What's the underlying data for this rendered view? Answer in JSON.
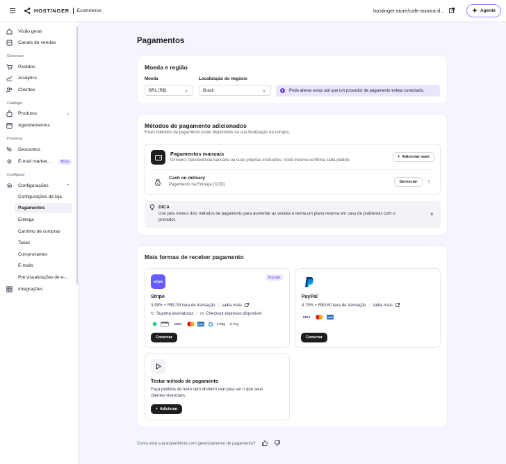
{
  "topbar": {
    "brand": "HOSTINGER",
    "product": "Ecommerce",
    "store_url": "hostinger.store/cafe-aurora-d...",
    "agent_label": "Agente"
  },
  "sidebar": {
    "items_top": [
      "Visão geral",
      "Canais de vendas"
    ],
    "section_gerenciar": "Gerenciar",
    "items_gerenciar": [
      "Pedidos",
      "Analytics",
      "Clientes"
    ],
    "section_catalogo": "Catálogo",
    "items_catalogo": [
      "Produtos",
      "Agendamentos"
    ],
    "section_promova": "Promova",
    "items_promova": [
      "Descontos",
      "E-mail market..."
    ],
    "novo_badge": "Novo",
    "section_configurar": "Configurar",
    "configuracoes": "Configurações",
    "sub_items": [
      "Configurações da loja",
      "Pagamentos",
      "Entrega",
      "Carrinho de compras",
      "Taxas",
      "Comprovantes",
      "E-mails",
      "Pré visualizações de e-..."
    ],
    "integracoes": "Integrações"
  },
  "main": {
    "title": "Pagamentos",
    "currency_card": {
      "title": "Moeda e região",
      "currency_label": "Moeda",
      "currency_value": "BRL (R$)",
      "location_label": "Localização do negócio",
      "location_value": "Brasil",
      "note": "Pode alterar estas até que um provedor de pagamento esteja conectado."
    },
    "methods_card": {
      "title": "Métodos de pagamento adicionados",
      "subtitle": "Estes métodos de pagamento estão disponíveis na sua finalização da compra.",
      "manual_title": "Pagamentos manuais",
      "manual_desc": "Dinheiro, transferência bancária ou suas próprias instruções. Você mesmo confirma cada pedido.",
      "add_more": "Adicionar mais",
      "cod_title": "Cash on delivery",
      "cod_desc": "Pagamento na Entrega (COD)",
      "manage": "Gerenciar",
      "tip_title": "DICA",
      "tip_text_1": "Use pelo menos dois métodos de pagamento para aumentar as vendas e tenha um plano reserva em caso de problemas com o",
      "tip_text_2": "provedor."
    },
    "more_card": {
      "title": "Mais formas de receber pagamento",
      "stripe": {
        "logo": "stripe",
        "badge": "Popular",
        "name": "Stripe",
        "fee": "3.99% + R$0.39 taxa de transação",
        "learn": "saiba mais",
        "feature_1": "Suporta assinaturas",
        "feature_2": "Checkout expresso disponível",
        "connect": "Conectar",
        "brands": [
          "VISA",
          "Pay",
          "G Pay"
        ]
      },
      "paypal": {
        "name": "PayPal",
        "fee": "4.79% + R$0.60 taxa de transação",
        "learn": "saiba mais",
        "connect": "Conectar",
        "brands": [
          "VISA"
        ]
      },
      "test": {
        "name": "Testar método de pagamento",
        "desc_1": "Faça pedidos de teste sem dinheiro real para ver o que seus",
        "desc_2": "clientes vivenciam.",
        "add": "Adicionar"
      }
    },
    "feedback": "Como está sua experiência com gerenciamento de pagamento?"
  },
  "colors": {
    "accent": "#673de6",
    "stripe": "#635bff",
    "paypal_blue": "#003087"
  }
}
